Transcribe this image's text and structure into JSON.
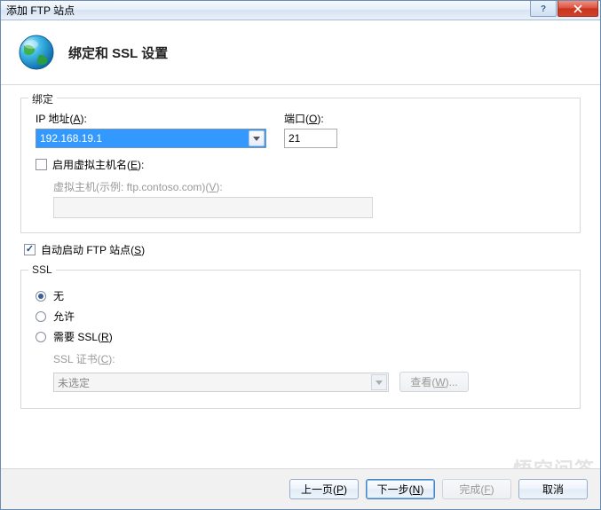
{
  "window": {
    "title": "添加 FTP 站点"
  },
  "titlebar": {
    "help_tip": "?",
    "close_tip": "X"
  },
  "header": {
    "title": "绑定和 SSL 设置"
  },
  "binding": {
    "legend": "绑定",
    "ip_label_pre": "IP 地址(",
    "ip_hotkey": "A",
    "ip_label_post": "):",
    "ip_value": "192.168.19.1",
    "port_label_pre": "端口(",
    "port_hotkey": "O",
    "port_label_post": "):",
    "port_value": "21",
    "vhost_enable_pre": "启用虚拟主机名(",
    "vhost_enable_hotkey": "E",
    "vhost_enable_post": "):",
    "vhost_label_pre": "虚拟主机(示例: ftp.contoso.com)(",
    "vhost_label_hotkey": "V",
    "vhost_label_post": "):",
    "vhost_value": ""
  },
  "autostart": {
    "label_pre": "自动启动 FTP 站点(",
    "hotkey": "S",
    "label_post": ")",
    "checked": true
  },
  "ssl": {
    "legend": "SSL",
    "radio_none": "无",
    "radio_allow": "允许",
    "radio_require_pre": "需要 SSL(",
    "radio_require_hotkey": "R",
    "radio_require_post": ")",
    "cert_label_pre": "SSL 证书(",
    "cert_hotkey": "C",
    "cert_label_post": "):",
    "cert_value": "未选定",
    "view_btn_pre": "查看(",
    "view_hotkey": "W",
    "view_btn_post": ")..."
  },
  "footer": {
    "prev_pre": "上一页(",
    "prev_hotkey": "P",
    "prev_post": ")",
    "next_pre": "下一步(",
    "next_hotkey": "N",
    "next_post": ")",
    "finish_pre": "完成(",
    "finish_hotkey": "F",
    "finish_post": ")",
    "cancel": "取消"
  },
  "watermark": "悟空问答"
}
